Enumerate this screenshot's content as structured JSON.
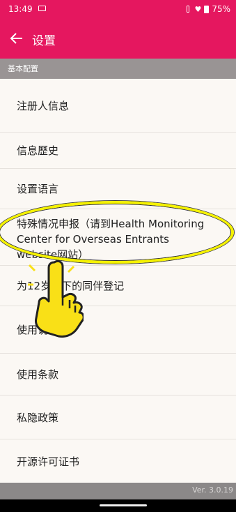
{
  "status_bar": {
    "time": "13:49",
    "battery": "75%"
  },
  "header": {
    "title": "设置"
  },
  "section": {
    "label": "基本配置"
  },
  "menu": {
    "items": [
      "注册人信息",
      "信息歷史",
      "设置语言",
      "特殊情况申报（请到Health Monitoring Center for Overseas Entrants website网站）",
      "为12岁以下的同伴登记",
      "使用说明书",
      "使用条款",
      "私隐政策",
      "开源许可证书"
    ]
  },
  "footer": {
    "version": "Ver. 3.0.19"
  },
  "icons": [
    "back-arrow-icon",
    "message-icon",
    "vibrate-icon",
    "wifi-icon",
    "battery-icon",
    "pointing-hand-icon"
  ],
  "colors": {
    "primary": "#e5175f",
    "section_header": "#999494",
    "highlight": "#f5f200"
  }
}
